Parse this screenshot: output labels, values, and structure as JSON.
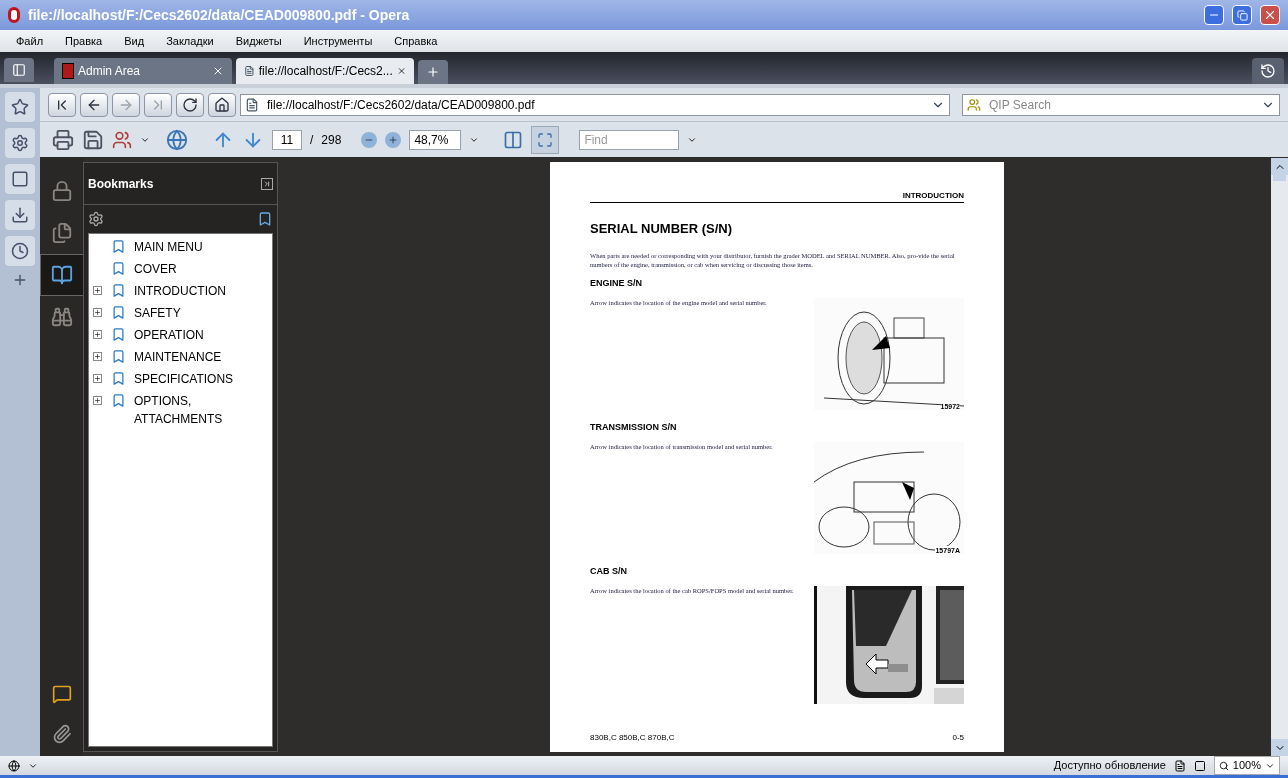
{
  "window": {
    "title": "file://localhost/F:/Cecs2602/data/CEAD009800.pdf - Opera"
  },
  "menu": [
    "Файл",
    "Правка",
    "Вид",
    "Закладки",
    "Виджеты",
    "Инструменты",
    "Справка"
  ],
  "tabs": [
    {
      "label": "Admin Area",
      "selected": false
    },
    {
      "label": "file://localhost/F:/Cecs2...",
      "selected": true
    }
  ],
  "address": {
    "url": "file://localhost/F:/Cecs2602/data/CEAD009800.pdf"
  },
  "search": {
    "placeholder": "QIP Search"
  },
  "pdf_toolbar": {
    "page": "11",
    "separator": "/",
    "page_total": "298",
    "zoom": "48,7%",
    "find_placeholder": "Find"
  },
  "acrobat_rail": [
    {
      "kind": "lock",
      "selected": false
    },
    {
      "kind": "pages",
      "selected": false
    },
    {
      "kind": "bookmarks",
      "selected": true
    },
    {
      "kind": "search",
      "selected": false
    }
  ],
  "bookmarks": {
    "title": "Bookmarks",
    "items": [
      {
        "label": "MAIN MENU",
        "expandable": false
      },
      {
        "label": "COVER",
        "expandable": false
      },
      {
        "label": "INTRODUCTION",
        "expandable": true
      },
      {
        "label": "SAFETY",
        "expandable": true
      },
      {
        "label": "OPERATION",
        "expandable": true
      },
      {
        "label": "MAINTENANCE",
        "expandable": true
      },
      {
        "label": "SPECIFICATIONS",
        "expandable": true
      },
      {
        "label": "OPTIONS, ATTACHMENTS",
        "expandable": true
      }
    ]
  },
  "page": {
    "header": "INTRODUCTION",
    "title": "SERIAL NUMBER (S/N)",
    "intro": "When parts are needed or corresponding with your distributor, furnish the grader MODEL and SERIAL NUMBER. Also, pro-vide the serial numbers of the engine, transmission, or cab when servicing or discussing those items.",
    "sections": [
      {
        "heading": "ENGINE S/N",
        "text": "Arrow indicates the location of the engine model and serial number.",
        "caption": "15972"
      },
      {
        "heading": "TRANSMISSION S/N",
        "text": "Arrow indicates the location of transmission model and serial number.",
        "caption": "15797A"
      },
      {
        "heading": "CAB S/N",
        "text": "Arrow indicates the location of the cab ROPS/FOPS model and serial number."
      }
    ],
    "footer": "830B,C 850B,C 870B,C",
    "page_number": "0-5"
  },
  "status_bar": {
    "text": "Доступно обновление",
    "zoom": "100%"
  }
}
